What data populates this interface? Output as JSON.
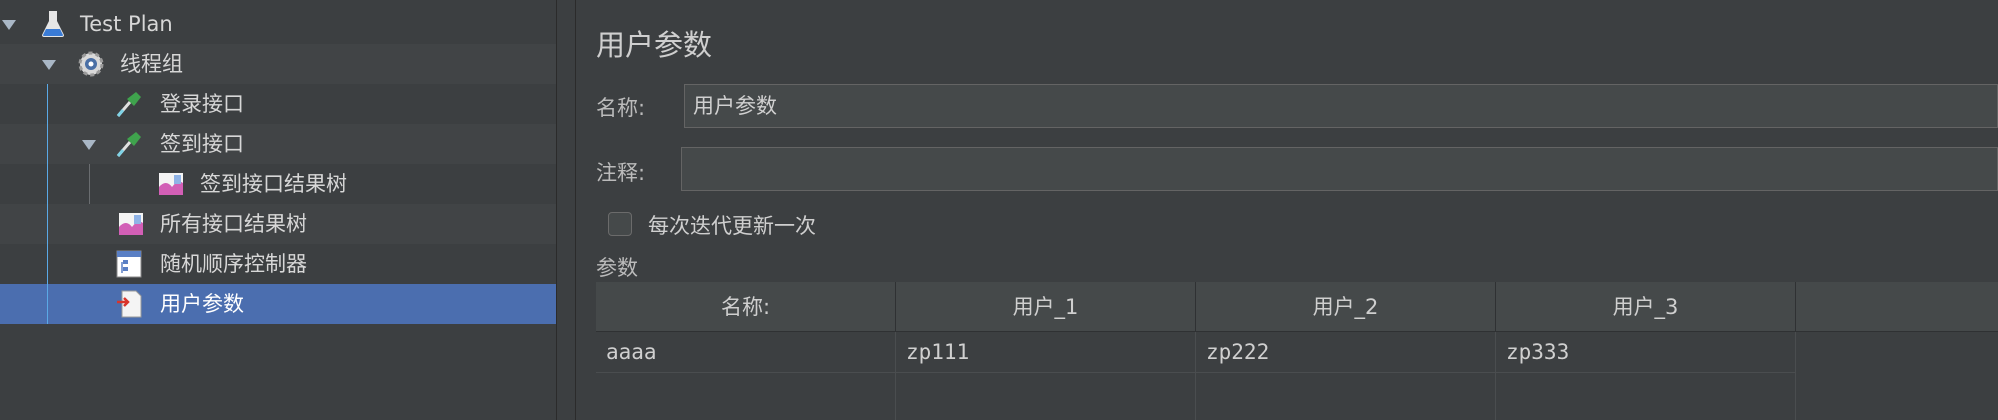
{
  "tree": {
    "items": [
      {
        "label": "Test Plan"
      },
      {
        "label": "线程组"
      },
      {
        "label": "登录接口"
      },
      {
        "label": "签到接口"
      },
      {
        "label": "签到接口结果树"
      },
      {
        "label": "所有接口结果树"
      },
      {
        "label": "随机顺序控制器"
      },
      {
        "label": "用户参数"
      }
    ]
  },
  "panel": {
    "title": "用户参数",
    "name_label": "名称:",
    "name_value": "用户参数",
    "comment_label": "注释:",
    "comment_value": "",
    "checkbox_label": "每次迭代更新一次",
    "checkbox_checked": false,
    "params_label": "参数"
  },
  "table": {
    "headers": [
      "名称:",
      "用户_1",
      "用户_2",
      "用户_3"
    ],
    "rows": [
      [
        "aaaa",
        "zp111",
        "zp222",
        "zp333"
      ]
    ]
  },
  "colors": {
    "selection": "#4b6eaf",
    "background": "#3c3f41",
    "tree_guide": "#5aa9e6"
  }
}
